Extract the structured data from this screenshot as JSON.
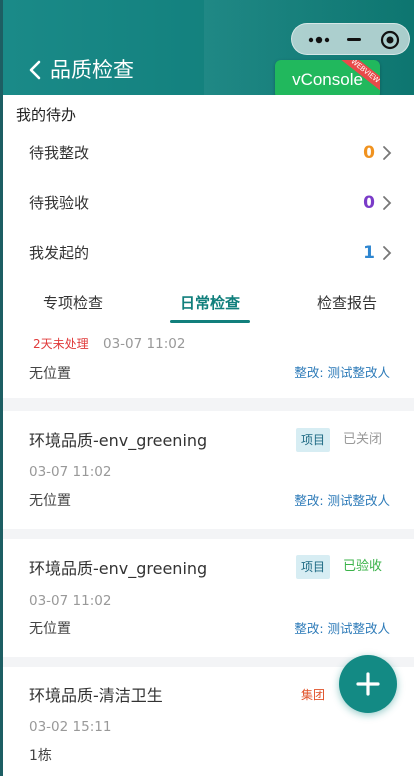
{
  "header": {
    "title": "品质检查"
  },
  "vconsole": {
    "label": "vConsole",
    "ribbon": "WEBVIEW"
  },
  "todo": {
    "section_title": "我的待办",
    "rows": [
      {
        "label": "待我整改",
        "count": "0",
        "color": "#f0921f"
      },
      {
        "label": "待我验收",
        "count": "0",
        "color": "#7a3bc8"
      },
      {
        "label": "我发起的",
        "count": "1",
        "color": "#2e86d0"
      }
    ]
  },
  "tabs": [
    {
      "label": "专项检查",
      "active": false
    },
    {
      "label": "日常检查",
      "active": true
    },
    {
      "label": "检查报告",
      "active": false
    }
  ],
  "items": [
    {
      "badge": "2天未处理",
      "time": "03-07 11:02",
      "location": "无位置",
      "assignee": "整改: 测试整改人"
    },
    {
      "name": "环境品质-env_greening",
      "tag": "项目",
      "status": "已关闭",
      "status_color": "#999999",
      "time": "03-07 11:02",
      "location": "无位置",
      "assignee": "整改: 测试整改人"
    },
    {
      "name": "环境品质-env_greening",
      "tag": "项目",
      "status": "已验收",
      "status_color": "#3bb34a",
      "time": "03-07 11:02",
      "location": "无位置",
      "assignee": "整改: 测试整改人"
    },
    {
      "name": "环境品质-清洁卫生",
      "tag": "集团",
      "time": "03-02 15:11",
      "location": "1栋"
    }
  ]
}
